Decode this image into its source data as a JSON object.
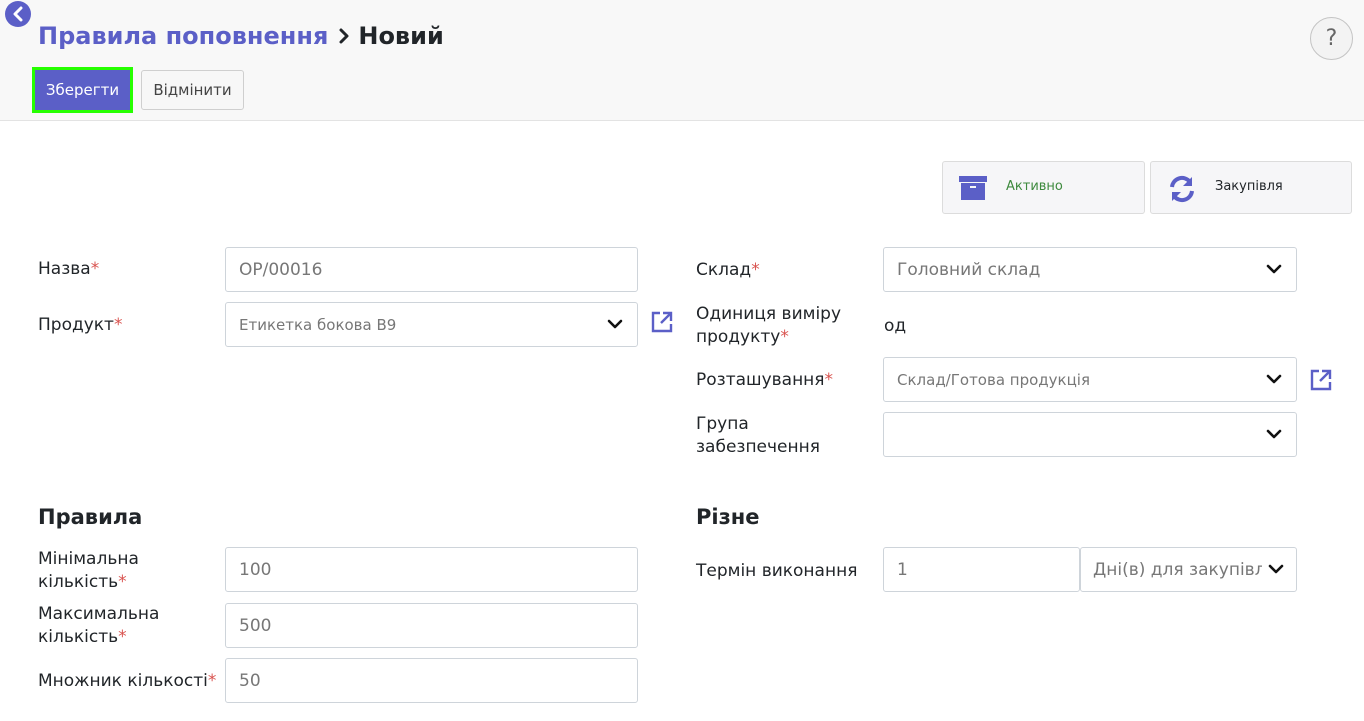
{
  "header": {
    "breadcrumb_parent": "Правила поповнення",
    "breadcrumb_current": "Новий",
    "help_label": "?"
  },
  "toolbar": {
    "save_label": "Зберегти",
    "discard_label": "Відмінити"
  },
  "smart_buttons": {
    "active_label": "Активно",
    "purchase_label": "Закупівля"
  },
  "form": {
    "name": {
      "label": "Назва",
      "value": "OP/00016"
    },
    "product": {
      "label": "Продукт",
      "value": "Етикетка бокова B9"
    },
    "warehouse": {
      "label": "Склад",
      "value": "Головний склад"
    },
    "uom": {
      "label_line1": "Одиниця виміру",
      "label_line2": "продукту",
      "value": "од"
    },
    "location": {
      "label": "Розташування",
      "value": "Склад/Готова продукція"
    },
    "procurement_group": {
      "label_line1": "Група",
      "label_line2": "забезпечення",
      "value": ""
    }
  },
  "rules": {
    "title": "Правила",
    "min_qty": {
      "label_line1": "Мінімальна",
      "label_line2": "кількість",
      "value": "100"
    },
    "max_qty": {
      "label_line1": "Максимальна",
      "label_line2": "кількість",
      "value": "500"
    },
    "qty_multiple": {
      "label": "Множник кількості",
      "value": "50"
    }
  },
  "misc": {
    "title": "Різне",
    "lead_time": {
      "label": "Термін виконання",
      "value": "1",
      "unit": "Дні(в) для закупівлі"
    }
  },
  "required_marker": "*",
  "colors": {
    "accent": "#5b5fc7",
    "highlight": "#26ff00",
    "required": "#d9534f",
    "active": "#3e8a3e"
  }
}
